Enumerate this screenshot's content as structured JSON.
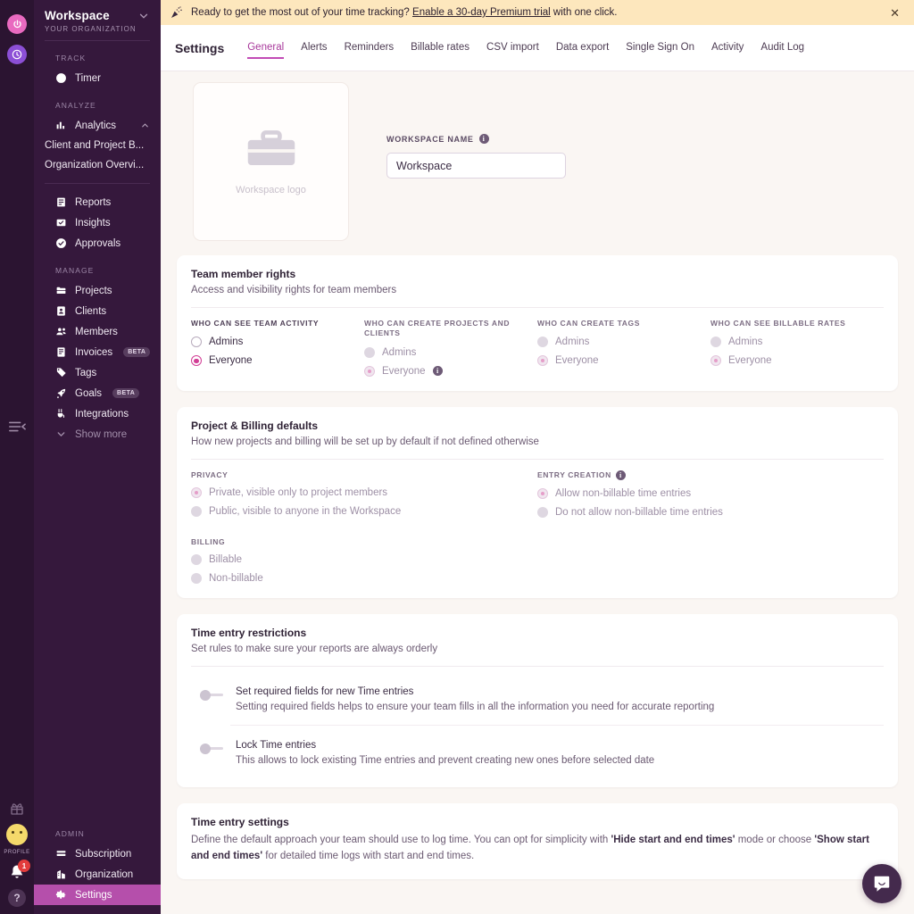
{
  "rail": {
    "power_icon": "power-icon",
    "clock_icon": "clock-icon",
    "collapse_icon": "collapse-sidebar-icon",
    "gift_icon": "gift-icon",
    "profile_label": "PROFILE",
    "notification_count": "1",
    "help_label": "?"
  },
  "sidebar": {
    "workspace_title": "Workspace",
    "workspace_subtitle": "YOUR ORGANIZATION",
    "sections": [
      {
        "label": "TRACK",
        "items": [
          {
            "label": "Timer",
            "icon": "clock-icon"
          }
        ]
      },
      {
        "label": "ANALYZE",
        "items": [
          {
            "label": "Analytics",
            "icon": "bar-chart-icon",
            "expanded": true
          },
          {
            "label": "Client and Project B...",
            "sub": true
          },
          {
            "label": "Organization Overvi...",
            "sub": true
          }
        ]
      },
      {
        "label": "",
        "items": [
          {
            "label": "Reports",
            "icon": "report-icon"
          },
          {
            "label": "Insights",
            "icon": "insights-icon"
          },
          {
            "label": "Approvals",
            "icon": "check-circle-icon"
          }
        ]
      },
      {
        "label": "MANAGE",
        "items": [
          {
            "label": "Projects",
            "icon": "folder-icon"
          },
          {
            "label": "Clients",
            "icon": "client-icon"
          },
          {
            "label": "Members",
            "icon": "members-icon"
          },
          {
            "label": "Invoices",
            "icon": "invoice-icon",
            "badge": "BETA"
          },
          {
            "label": "Tags",
            "icon": "tag-icon"
          },
          {
            "label": "Goals",
            "icon": "rocket-icon",
            "badge": "BETA"
          },
          {
            "label": "Integrations",
            "icon": "plug-icon"
          },
          {
            "label": "Show more",
            "icon": "chevron-down-icon",
            "muted": true
          }
        ]
      },
      {
        "label": "ADMIN",
        "items": [
          {
            "label": "Subscription",
            "icon": "card-icon"
          },
          {
            "label": "Organization",
            "icon": "building-icon"
          },
          {
            "label": "Settings",
            "icon": "gear-icon",
            "active": true
          }
        ]
      }
    ]
  },
  "banner": {
    "icon": "party-popper-icon",
    "text_before": "Ready to get the most out of your time tracking?",
    "link_text": "Enable a 30-day Premium trial",
    "text_after": "with one click.",
    "close_label": "✕"
  },
  "header": {
    "page_title": "Settings",
    "tabs": [
      {
        "label": "General",
        "active": true
      },
      {
        "label": "Alerts",
        "active": false
      },
      {
        "label": "Reminders",
        "active": false
      },
      {
        "label": "Billable rates",
        "active": false
      },
      {
        "label": "CSV import",
        "active": false
      },
      {
        "label": "Data export",
        "active": false
      },
      {
        "label": "Single Sign On",
        "active": false
      },
      {
        "label": "Activity",
        "active": false
      },
      {
        "label": "Audit Log",
        "active": false
      }
    ]
  },
  "workspace": {
    "logo_caption": "Workspace logo",
    "name_label": "WORKSPACE NAME",
    "name_value": "Workspace",
    "name_placeholder": "Workspace"
  },
  "team_rights": {
    "title": "Team member rights",
    "subtitle": "Access and visibility rights for team members",
    "groups": [
      {
        "label": "WHO CAN SEE TEAM ACTIVITY",
        "disabled": false,
        "info": false,
        "options": [
          {
            "label": "Admins",
            "selected": false,
            "info": false
          },
          {
            "label": "Everyone",
            "selected": true,
            "info": false
          }
        ]
      },
      {
        "label": "WHO CAN CREATE PROJECTS AND CLIENTS",
        "disabled": true,
        "info": false,
        "options": [
          {
            "label": "Admins",
            "selected": false,
            "info": false
          },
          {
            "label": "Everyone",
            "selected": true,
            "info": true
          }
        ]
      },
      {
        "label": "WHO CAN CREATE TAGS",
        "disabled": true,
        "info": false,
        "options": [
          {
            "label": "Admins",
            "selected": false,
            "info": false
          },
          {
            "label": "Everyone",
            "selected": true,
            "info": false
          }
        ]
      },
      {
        "label": "WHO CAN SEE BILLABLE RATES",
        "disabled": true,
        "info": false,
        "options": [
          {
            "label": "Admins",
            "selected": false,
            "info": false
          },
          {
            "label": "Everyone",
            "selected": true,
            "info": false
          }
        ]
      }
    ]
  },
  "project_billing": {
    "title": "Project & Billing defaults",
    "subtitle": "How new projects and billing will be set up by default if not defined otherwise",
    "privacy": {
      "label": "PRIVACY",
      "options": [
        {
          "label": "Private, visible only to project members",
          "selected": true
        },
        {
          "label": "Public, visible to anyone in the Workspace",
          "selected": false
        }
      ]
    },
    "entry_creation": {
      "label": "ENTRY CREATION",
      "info": true,
      "options": [
        {
          "label": "Allow non-billable time entries",
          "selected": true
        },
        {
          "label": "Do not allow non-billable time entries",
          "selected": false
        }
      ]
    },
    "billing": {
      "label": "BILLING",
      "options": [
        {
          "label": "Billable",
          "selected": false
        },
        {
          "label": "Non-billable",
          "selected": false
        }
      ]
    }
  },
  "time_restrictions": {
    "title": "Time entry restrictions",
    "subtitle": "Set rules to make sure your reports are always orderly",
    "rows": [
      {
        "title": "Set required fields for new Time entries",
        "desc": "Setting required fields helps to ensure your team fills in all the information you need for accurate reporting",
        "on": false
      },
      {
        "title": "Lock Time entries",
        "desc": "This allows to lock existing Time entries and prevent creating new ones before selected date",
        "on": false
      }
    ]
  },
  "time_entry_settings": {
    "title": "Time entry settings",
    "desc_1": "Define the default approach your team should use to log time. You can opt for simplicity with ",
    "bold_1": "'Hide start and end times'",
    "desc_2": " mode or choose ",
    "bold_2": "'Show start and end times'",
    "desc_3": " for detailed time logs with start and end times."
  },
  "intercom": {
    "label": "open-messenger"
  },
  "colors": {
    "sidebar_bg": "#35183c",
    "rail_bg": "#2b1431",
    "active_nav": "#b54fab",
    "accent": "#c14bb5",
    "radio_on": "#d23d95",
    "banner_bg": "#fde7bd",
    "page_bg": "#faf6f3"
  }
}
